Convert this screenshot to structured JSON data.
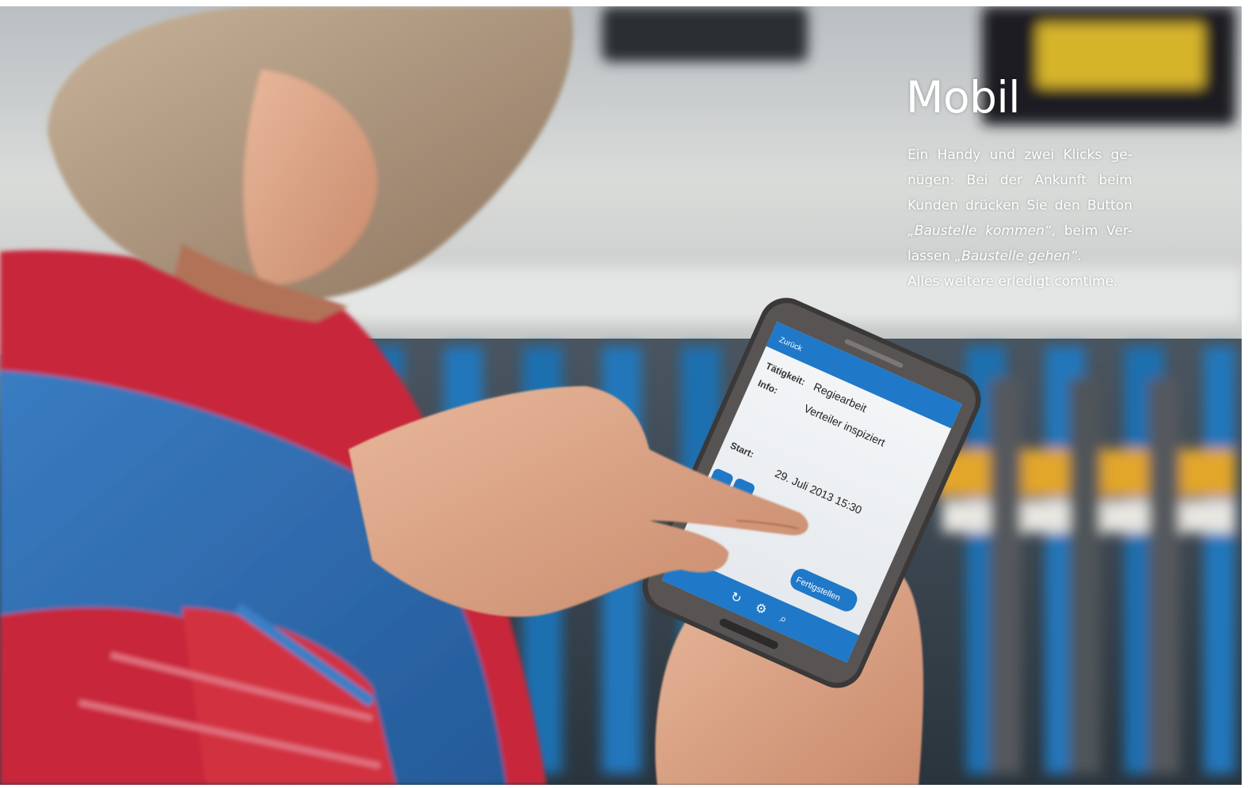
{
  "article": {
    "title": "Mobil",
    "paragraph": {
      "line1": "Ein Handy und zwei Klicks ge-",
      "line2": "nügen: Bei der Ankunft beim",
      "line3": "Kunden drücken Sie den Button",
      "line4_quote": "„Baustelle kommen“",
      "line4_rest": ", beim Ver-",
      "line5_prefix": "lassen ",
      "line5_quote": "„Baustelle gehen“",
      "line5_suffix": ".",
      "line6": "Alles weitere erledigt comtime."
    }
  },
  "phone_screen": {
    "back_button": "Zurück",
    "activity_label": "Tätigkeit:",
    "activity_value": "Regiearbeit",
    "info_label": "Info:",
    "info_value": "Verteiler inspiziert",
    "start_label": "Start:",
    "start_value": "29. Juli 2013 15:30",
    "finish_button": "Fertigstellen"
  },
  "colors": {
    "shirt_red": "#c8283a",
    "vest_blue": "#2f6fb4",
    "app_blue": "#1f78c8",
    "text": "#ffffff"
  }
}
